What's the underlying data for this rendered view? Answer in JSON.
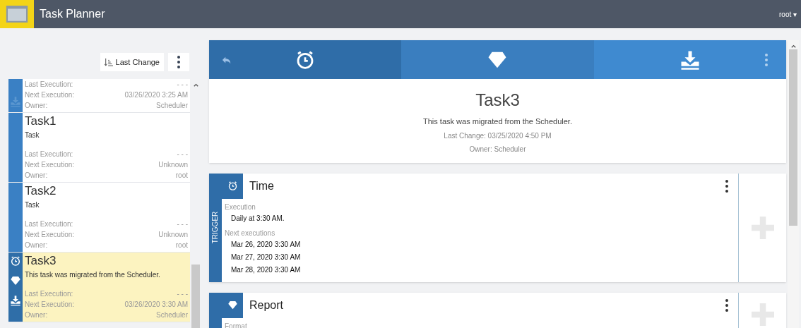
{
  "app": {
    "title": "Task Planner",
    "user": "root ▾"
  },
  "sort_button": {
    "label": "Last Change"
  },
  "tasks": [
    {
      "selected": false,
      "kind": "download",
      "rows": [
        {
          "label": "Last Execution:",
          "value": "- - -"
        },
        {
          "label": "Next Execution:",
          "value": "03/26/2020 3:25 AM"
        },
        {
          "label": "Owner:",
          "value": "Scheduler"
        }
      ]
    },
    {
      "selected": false,
      "kind": "plain",
      "name": "Task1",
      "description": "Task",
      "rows": [
        {
          "label": "Last Execution:",
          "value": "- - -"
        },
        {
          "label": "Next Execution:",
          "value": "Unknown"
        },
        {
          "label": "Owner:",
          "value": "root"
        }
      ]
    },
    {
      "selected": false,
      "kind": "plain",
      "name": "Task2",
      "description": "Task",
      "rows": [
        {
          "label": "Last Execution:",
          "value": "- - -"
        },
        {
          "label": "Next Execution:",
          "value": "Unknown"
        },
        {
          "label": "Owner:",
          "value": "root"
        }
      ]
    },
    {
      "selected": true,
      "kind": "full",
      "name": "Task3",
      "description": "This task was migrated from the Scheduler.",
      "rows": [
        {
          "label": "Last Execution:",
          "value": "- - -"
        },
        {
          "label": "Next Execution:",
          "value": "03/26/2020 3:30 AM"
        },
        {
          "label": "Owner:",
          "value": "Scheduler"
        }
      ]
    }
  ],
  "detail": {
    "title": "Task3",
    "description": "This task was migrated from the Scheduler.",
    "last_change": "Last Change: 03/25/2020 4:50 PM",
    "owner": "Owner: Scheduler",
    "steps": [
      {
        "kind": "clock"
      },
      {
        "kind": "gem"
      },
      {
        "kind": "download"
      }
    ],
    "sections": [
      {
        "kind": "clock",
        "side_label": "TRIGGER",
        "title": "Time",
        "fields": [
          {
            "label": "Execution",
            "values": [
              "Daily at 3:30 AM."
            ]
          },
          {
            "label": "Next executions",
            "values": [
              "Mar 26, 2020 3:30 AM",
              "Mar 27, 2020 3:30 AM",
              "Mar 28, 2020 3:30 AM"
            ]
          }
        ]
      },
      {
        "kind": "gem",
        "title": "Report",
        "fields": [
          {
            "label": "Format"
          }
        ]
      }
    ]
  }
}
